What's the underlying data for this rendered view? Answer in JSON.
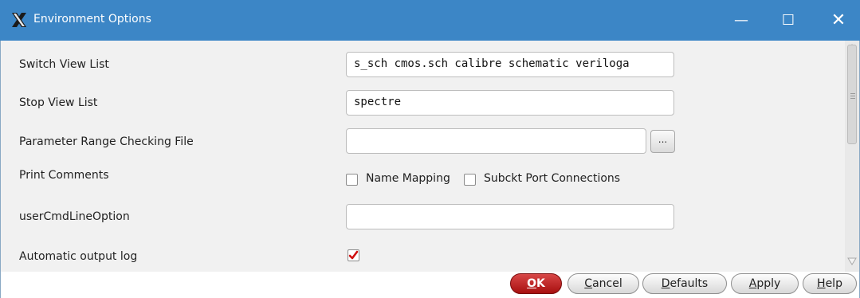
{
  "window": {
    "title": "Environment Options",
    "controls": {
      "minimize": "—",
      "maximize": "☐",
      "close": "✕"
    }
  },
  "form": {
    "switch_view_list": {
      "label": "Switch View List",
      "value": "s_sch cmos.sch calibre schematic veriloga"
    },
    "stop_view_list": {
      "label": "Stop View List",
      "value": "spectre"
    },
    "param_range_file": {
      "label": "Parameter Range Checking File",
      "value": "",
      "browse": "..."
    },
    "print_comments": {
      "label": "Print Comments",
      "options": [
        {
          "label": "Name Mapping",
          "checked": false
        },
        {
          "label": "Subckt Port Connections",
          "checked": false
        }
      ]
    },
    "user_cmd_line": {
      "label": "userCmdLineOption",
      "value": ""
    },
    "auto_output_log": {
      "label": "Automatic output log",
      "checked": true
    }
  },
  "buttons": {
    "ok": {
      "key": "O",
      "rest": "K"
    },
    "cancel": {
      "key": "C",
      "rest": "ancel"
    },
    "defaults": {
      "key": "D",
      "rest": "efaults"
    },
    "apply": {
      "key": "A",
      "rest": "pply"
    },
    "help": {
      "key": "H",
      "rest": "elp"
    }
  },
  "colors": {
    "titlebar": "#3c86c6",
    "ok_button": "#c02020",
    "check_mark": "#d01010"
  }
}
